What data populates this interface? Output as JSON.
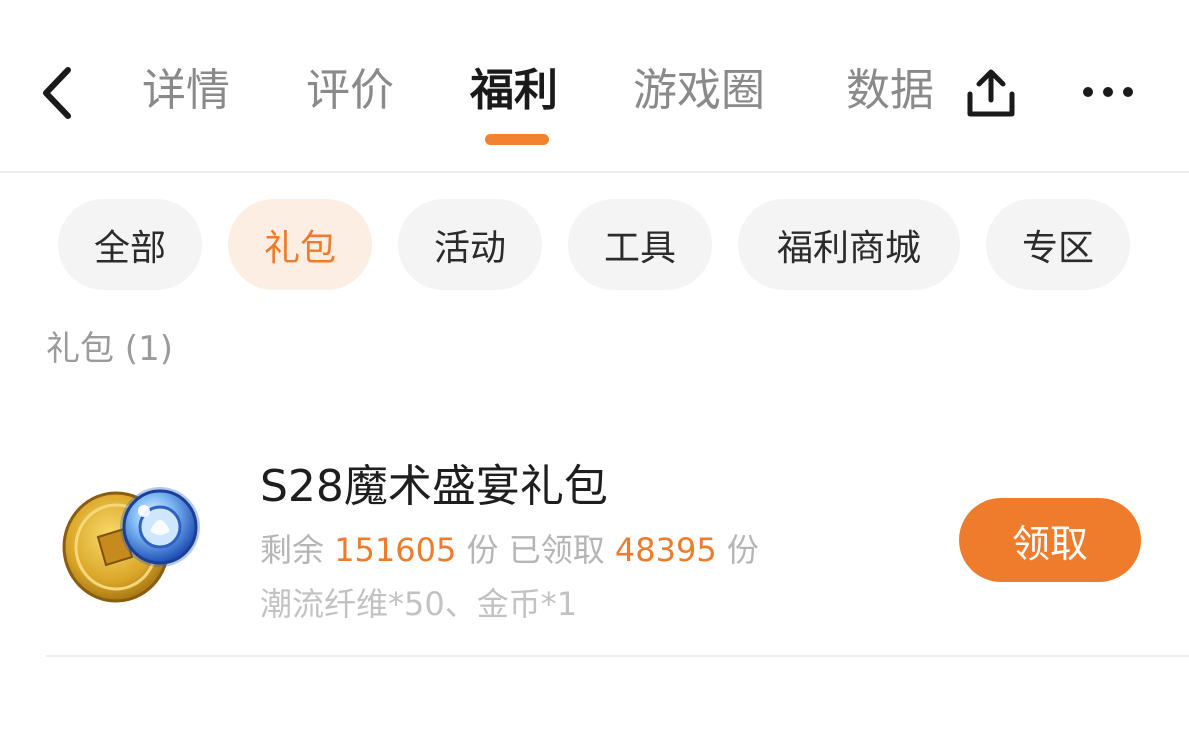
{
  "nav": {
    "tabs": [
      {
        "label": "详情"
      },
      {
        "label": "评价"
      },
      {
        "label": "福利"
      },
      {
        "label": "游戏圈"
      },
      {
        "label": "数据"
      }
    ],
    "active_tab": "福利",
    "back_icon": "chevron-left-icon",
    "share_icon": "share-icon",
    "more_icon": "more-icon"
  },
  "filters": {
    "chips": [
      "全部",
      "礼包",
      "活动",
      "工具",
      "福利商城",
      "专区"
    ],
    "active": "礼包"
  },
  "section": {
    "title": "礼包 (1)"
  },
  "gifts": [
    {
      "name": "S28魔术盛宴礼包",
      "remaining_label": "剩余",
      "remaining": "151605",
      "unit": "份",
      "claimed_label": "已领取",
      "claimed": "48395",
      "rewards": "潮流纤维*50、金币*1",
      "claim_label": "领取",
      "icon": "gift-pack-icon"
    }
  ],
  "colors": {
    "accent": "#ef7c2d",
    "chip_active_bg": "#fdeee3",
    "chip_bg": "#f4f4f4"
  }
}
